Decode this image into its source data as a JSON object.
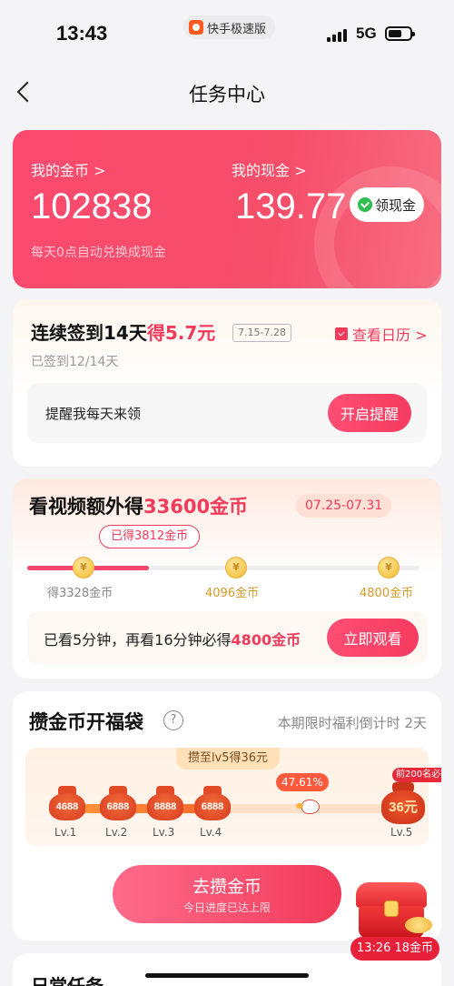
{
  "status_bar": {
    "time": "13:43",
    "app_name": "快手极速版",
    "network": "5G"
  },
  "nav": {
    "title": "任务中心"
  },
  "wallet": {
    "coins_label": "我的金币 >",
    "coins_value": "102838",
    "cash_label": "我的现金 >",
    "cash_value": "139.77",
    "withdraw_label": "领现金",
    "hint": "每天0点自动兑换成现金"
  },
  "signin": {
    "title_prefix": "连续签到14天",
    "title_reward": "得5.7元",
    "date_range": "7.15-7.28",
    "calendar_link": "查看日历 >",
    "progress_text": "已签到12/14天",
    "reminder_text": "提醒我每天来领",
    "reminder_button": "开启提醒"
  },
  "video": {
    "title_prefix": "看视频额外得",
    "title_amount": "33600金币",
    "date_range": "07.25-07.31",
    "earned_tip": "已得3812金币",
    "progress_fraction": 0.31,
    "milestones": [
      {
        "label": "得3328金币",
        "color": "#888888"
      },
      {
        "label": "4096金币",
        "color": "#d49a2a"
      },
      {
        "label": "4800金币",
        "color": "#d49a2a"
      }
    ],
    "watch_text_prefix": "已看5分钟，再看16分钟必得",
    "watch_text_amount": "4800金币",
    "watch_button": "立即观看"
  },
  "lucky_bag": {
    "title": "攒金币开福袋",
    "help_icon": "?",
    "countdown": "本期限时福利倒计时 2天",
    "goal_tag": "攒至lv5得36元",
    "progress_percent": "47.61%",
    "progress_fraction": 0.4761,
    "levels": [
      {
        "label": "Lv.1",
        "coins": "4688"
      },
      {
        "label": "Lv.2",
        "coins": "6888"
      },
      {
        "label": "Lv.3",
        "coins": "8888"
      },
      {
        "label": "Lv.4",
        "coins": "6888"
      }
    ],
    "final_level": {
      "label": "Lv.5",
      "reward": "36元",
      "tag": "前200名必得"
    },
    "collect_button": "去攒金币",
    "collect_button_sub": "今日进度已达上限"
  },
  "daily": {
    "title": "日常任务"
  },
  "floating_chest": {
    "timer_text": "13:26 18金币"
  }
}
